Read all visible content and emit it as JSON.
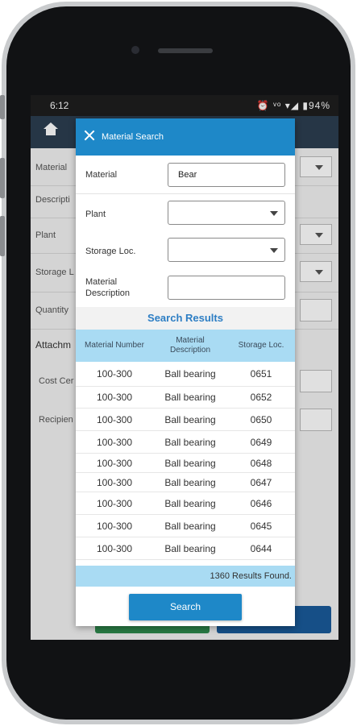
{
  "status_bar": {
    "time": "6:12",
    "icons_text": "⏰ ᵛᵒ ▾◢ ▮94%",
    "icons": [
      "alarm-icon",
      "volte-icon",
      "wifi-icon",
      "signal-icon",
      "battery-icon"
    ]
  },
  "app_bar": {
    "home_icon": "home-icon"
  },
  "background_form": {
    "labels": [
      "Material",
      "Descripti",
      "Plant",
      "Storage L",
      "Quantity",
      "Attachm",
      "Cost Cer",
      "Recipien"
    ]
  },
  "modal": {
    "title": "Material Search",
    "fields": {
      "material": {
        "label": "Material",
        "value": "Bear"
      },
      "plant": {
        "label": "Plant",
        "value": ""
      },
      "storage_loc": {
        "label": "Storage Loc.",
        "value": ""
      },
      "material_description": {
        "label": "Material Description",
        "value": ""
      }
    },
    "results_title": "Search Results",
    "columns": [
      "Material Number",
      "Material Description",
      "Storage Loc."
    ],
    "rows": [
      [
        "100-300",
        "Ball bearing",
        "0651"
      ],
      [
        "100-300",
        "Ball bearing",
        "0652"
      ],
      [
        "100-300",
        "Ball bearing",
        "0650"
      ],
      [
        "100-300",
        "Ball bearing",
        "0649"
      ],
      [
        "100-300",
        "Ball bearing",
        "0648"
      ],
      [
        "100-300",
        "Ball bearing",
        "0647"
      ],
      [
        "100-300",
        "Ball bearing",
        "0646"
      ],
      [
        "100-300",
        "Ball bearing",
        "0645"
      ],
      [
        "100-300",
        "Ball bearing",
        "0644"
      ]
    ],
    "results_count": "1360 Results Found.",
    "search_button": "Search"
  },
  "colors": {
    "header_blue": "#1e88c8",
    "table_header": "#a9dbf3",
    "results_title": "#2d7ec4"
  }
}
